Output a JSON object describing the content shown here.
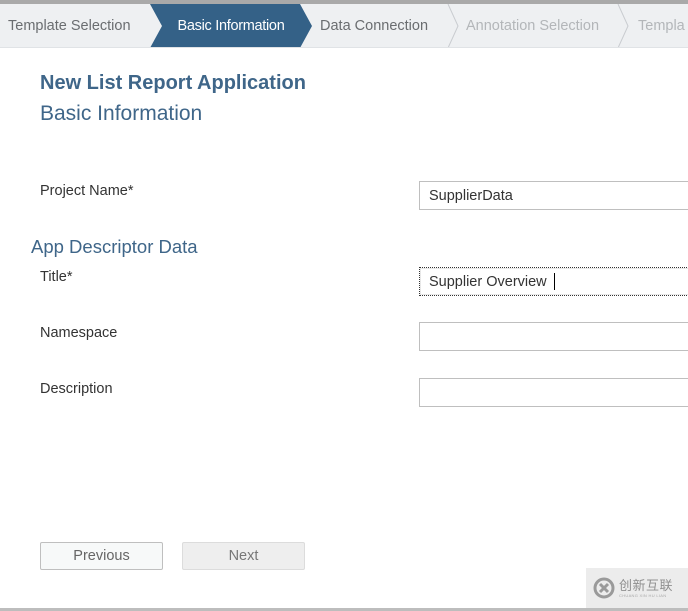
{
  "wizard": {
    "steps": [
      {
        "label": "Template Selection",
        "state": "done"
      },
      {
        "label": "Basic Information",
        "state": "active"
      },
      {
        "label": "Data Connection",
        "state": "next"
      },
      {
        "label": "Annotation Selection",
        "state": "disabled"
      },
      {
        "label": "Templa",
        "state": "disabled"
      }
    ]
  },
  "page": {
    "title": "New List Report Application",
    "subtitle": "Basic Information"
  },
  "form": {
    "project_name": {
      "label": "Project Name*",
      "value": "SupplierData"
    },
    "section_title": "App Descriptor Data",
    "title": {
      "label": "Title*",
      "value": "Supplier Overview"
    },
    "namespace": {
      "label": "Namespace",
      "value": ""
    },
    "description": {
      "label": "Description",
      "value": ""
    }
  },
  "buttons": {
    "previous": "Previous",
    "next": "Next"
  },
  "watermark": {
    "text_cn": "创新互联",
    "text_en": "CHUANG XIN HU LIAN"
  },
  "colors": {
    "accent": "#346187",
    "heading": "#3f6689"
  }
}
